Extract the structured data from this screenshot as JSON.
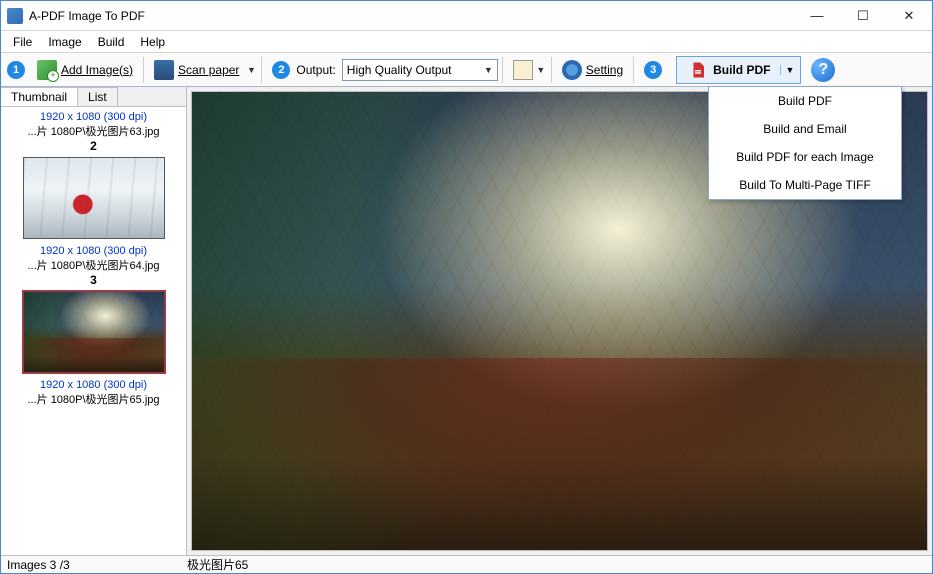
{
  "window": {
    "title": "A-PDF Image To PDF"
  },
  "menubar": {
    "items": [
      "File",
      "Image",
      "Build",
      "Help"
    ]
  },
  "toolbar": {
    "step1": "1",
    "add_images_label": "Add Image(s)",
    "scan_paper_label": "Scan paper",
    "step2": "2",
    "output_label": "Output:",
    "output_selected": "High Quality Output",
    "setting_label": "Setting",
    "step3": "3",
    "build_pdf_label": "Build PDF"
  },
  "sidebar": {
    "tabs": {
      "thumbnail": "Thumbnail",
      "list": "List"
    },
    "items": [
      {
        "meta": "1920 x 1080 (300 dpi)",
        "name": "...片 1080P\\极光图片63.jpg",
        "index": "2"
      },
      {
        "meta": "1920 x 1080 (300 dpi)",
        "name": "...片 1080P\\极光图片64.jpg",
        "index": "3"
      },
      {
        "meta": "1920 x 1080 (300 dpi)",
        "name": "...片 1080P\\极光图片65.jpg"
      }
    ]
  },
  "dropdown": {
    "items": [
      "Build PDF",
      "Build and Email",
      "Build PDF for each Image",
      "Build To Multi-Page TIFF"
    ]
  },
  "status": {
    "left": "Images 3 /3",
    "mid": "极光图片65"
  }
}
